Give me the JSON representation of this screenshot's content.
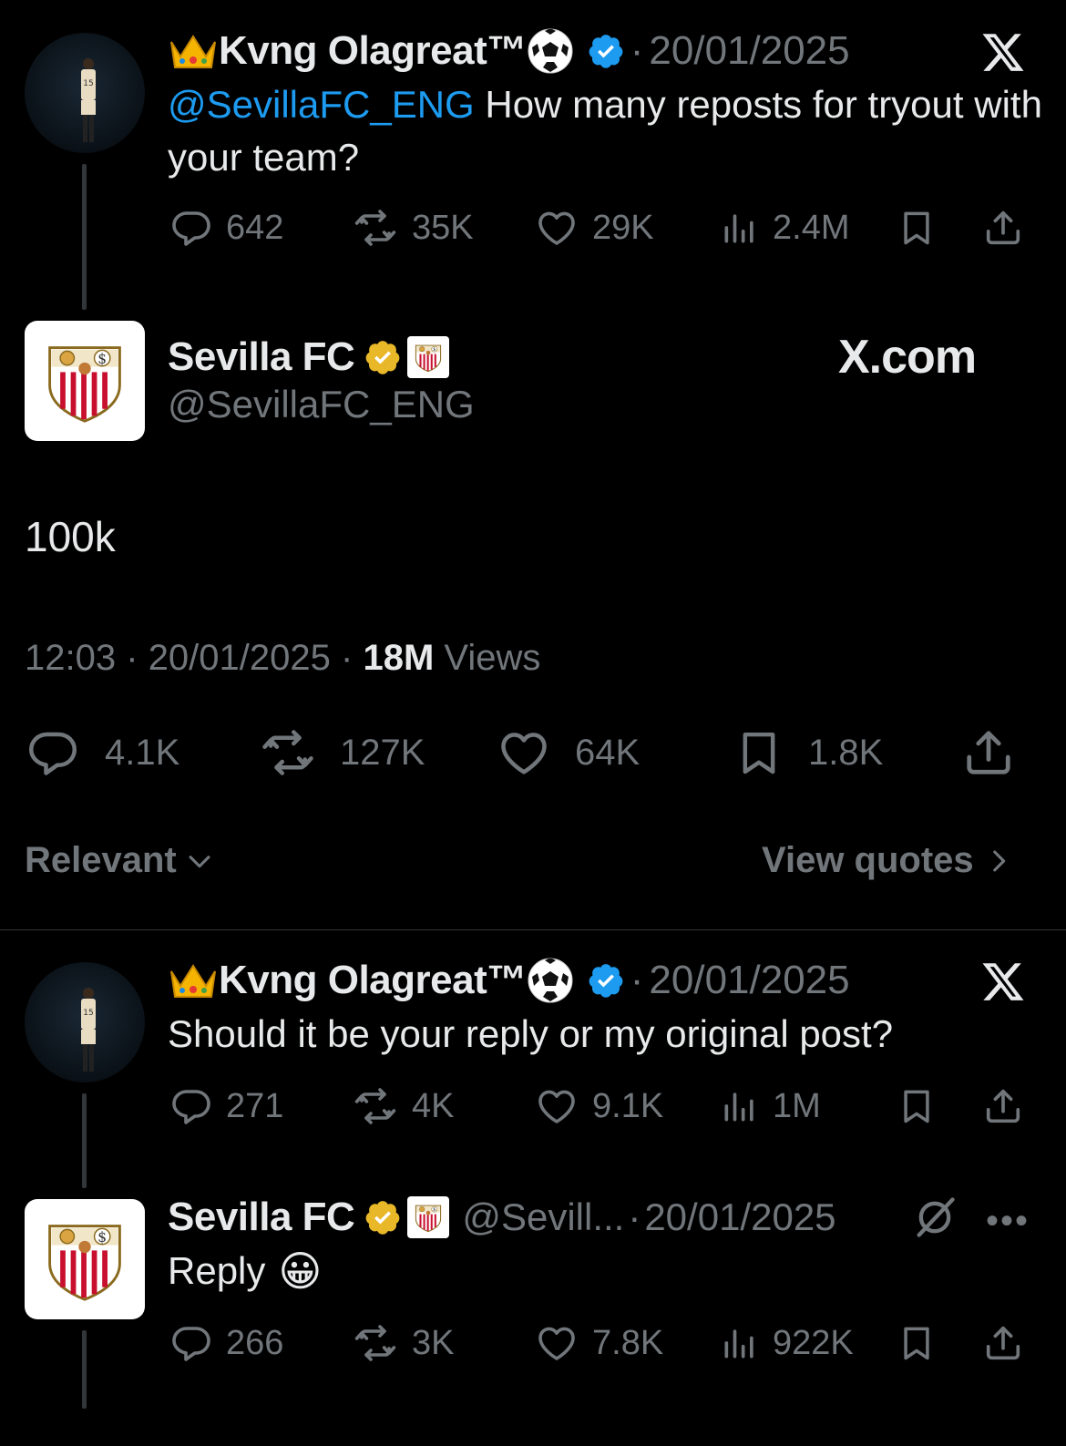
{
  "tweet1": {
    "author_name": "Kvng Olagreat™",
    "date": "20/01/2025",
    "mention": "@SevillaFC_ENG",
    "text": " How many reposts for tryout with your team?",
    "replies": "642",
    "reposts": "35K",
    "likes": "29K",
    "views": "2.4M"
  },
  "main_tweet": {
    "author_name": "Sevilla FC",
    "handle": "@SevillaFC_ENG",
    "watermark": "X.com",
    "text": "100k",
    "time": "12:03",
    "date": "20/01/2025",
    "views_count": "18M",
    "views_label": "Views",
    "replies": "4.1K",
    "reposts": "127K",
    "likes": "64K",
    "bookmarks": "1.8K"
  },
  "sort": {
    "label": "Relevant",
    "view_quotes": "View quotes"
  },
  "reply1": {
    "author_name": "Kvng Olagreat™",
    "date": "20/01/2025",
    "text": "Should it be your reply or my original post?",
    "replies": "271",
    "reposts": "4K",
    "likes": "9.1K",
    "views": "1M"
  },
  "reply2": {
    "author_name": "Sevilla FC",
    "handle": "@Sevill...",
    "date": "20/01/2025",
    "text": "Reply",
    "emoji": "😀",
    "replies": "266",
    "reposts": "3K",
    "likes": "7.8K",
    "views": "922K"
  },
  "colors": {
    "background": "#000000",
    "text": "#e7e9ea",
    "muted": "#71767b",
    "link_blue": "#1d9bf0",
    "verified_gold": "#e8b829",
    "sevilla_red": "#c8102e"
  },
  "separator": "·",
  "icons": [
    "reply-icon",
    "repost-icon",
    "like-icon",
    "views-icon",
    "bookmark-icon",
    "share-icon",
    "x-logo-icon",
    "verified-badge-icon",
    "crown-emoji",
    "soccer-ball-emoji",
    "sevilla-crest",
    "chevron-down-icon",
    "chevron-right-icon",
    "more-icon",
    "grok-icon"
  ]
}
